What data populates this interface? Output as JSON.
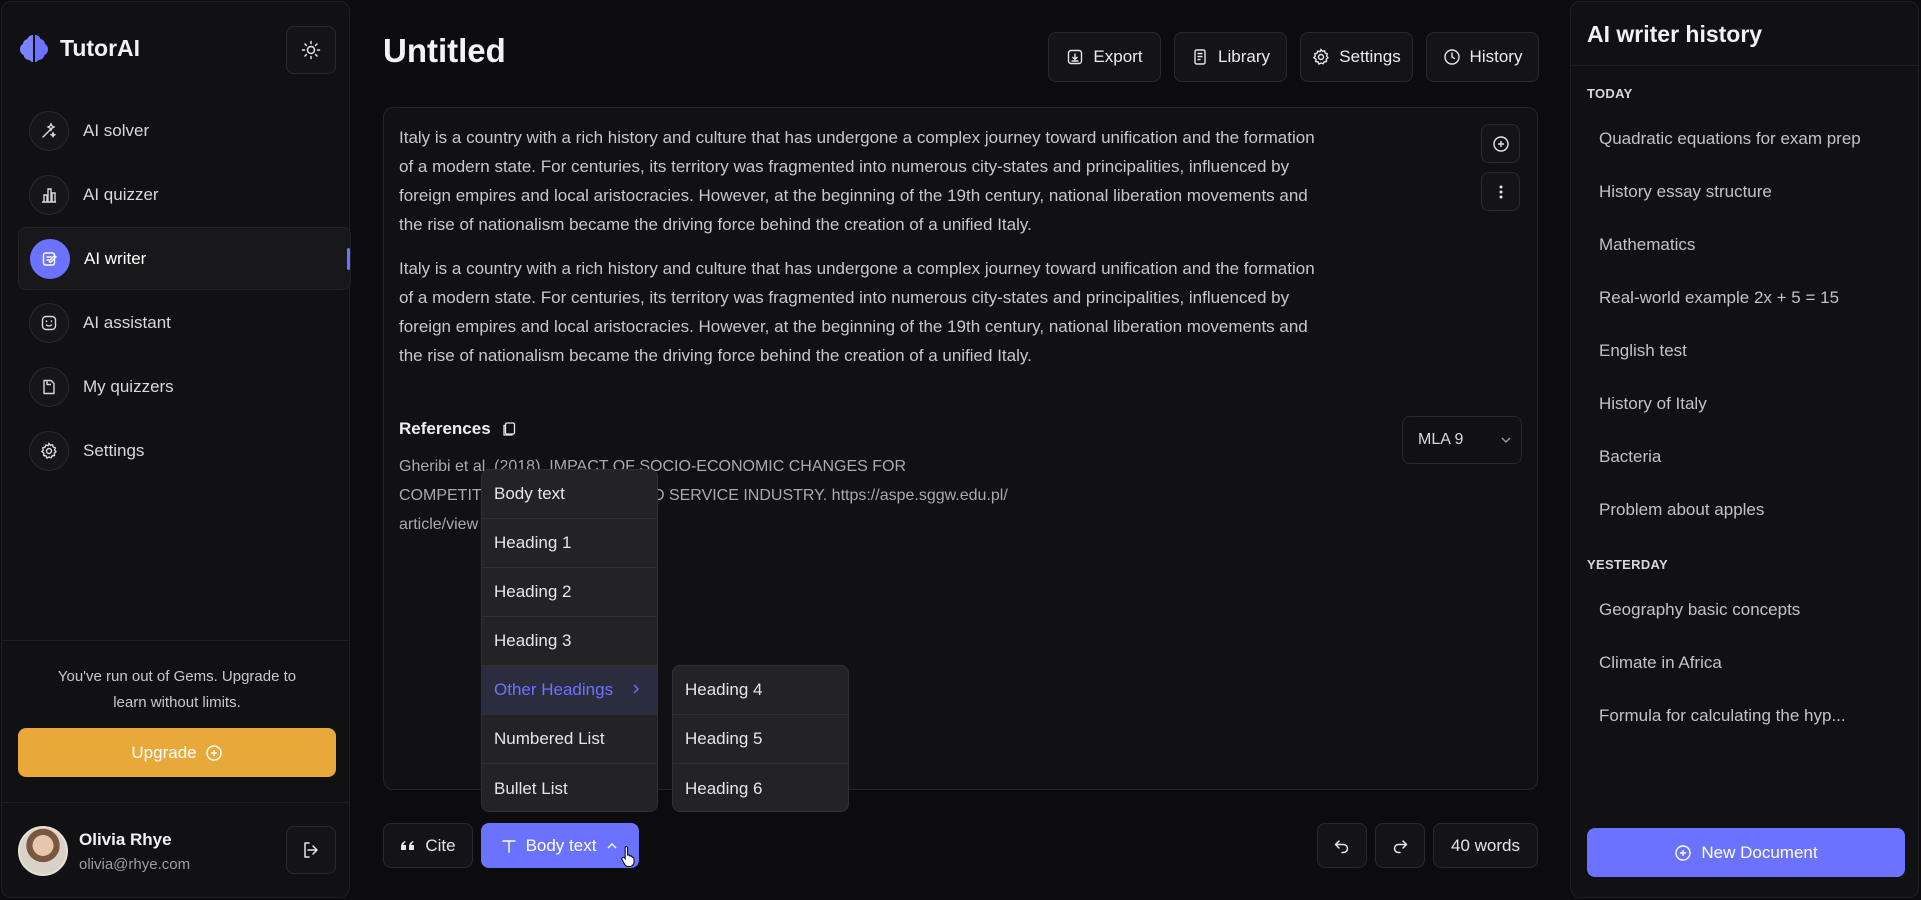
{
  "sidebar": {
    "brand": "TutorAI",
    "nav": [
      {
        "label": "AI solver",
        "icon": "magic-wand-icon"
      },
      {
        "label": "AI quizzer",
        "icon": "bar-chart-icon"
      },
      {
        "label": "AI writer",
        "icon": "edit-icon",
        "active": true
      },
      {
        "label": "AI assistant",
        "icon": "smile-icon"
      },
      {
        "label": "My quizzers",
        "icon": "document-icon"
      },
      {
        "label": "Settings",
        "icon": "gear-icon"
      }
    ],
    "upgrade_message": "You've run out of Gems. Upgrade to learn without limits.",
    "upgrade_label": "Upgrade",
    "user": {
      "name": "Olivia Rhye",
      "email": "olivia@rhye.com"
    }
  },
  "header": {
    "title": "Untitled",
    "buttons": {
      "export": "Export",
      "library": "Library",
      "settings": "Settings",
      "history": "History"
    }
  },
  "editor": {
    "paragraph1": "Italy is a country with a rich history and culture that has undergone a complex journey toward unification and the formation of a modern state. For centuries, its territory was fragmented into numerous city-states and principalities, influenced by foreign empires and local aristocracies. However, at the beginning of the 19th century, national liberation movements and the rise of nationalism became the driving force behind the creation of a unified Italy.",
    "paragraph2": "Italy is a country with a rich history and culture that has undergone a complex journey toward unification and the formation of a modern state. For centuries, its territory was fragmented into numerous city-states and principalities, influenced by foreign empires and local aristocracies. However, at the beginning of the 19th century, national liberation movements and the rise of nationalism became the driving force behind the creation of a unified Italy.",
    "references_title": "References",
    "reference_line1": "Gheribi et al. (2018). IMPACT OF SOCIO-ECONOMIC CHANGES FOR",
    "reference_line2": "COMPETITIVENESS OF THE FOOD SERVICE INDUSTRY. https://aspe.sggw.edu.pl/",
    "reference_line3": "article/view",
    "citation_style": "MLA 9"
  },
  "format_menu": {
    "items": [
      "Body text",
      "Heading 1",
      "Heading 2",
      "Heading 3",
      "Other Headings",
      "Numbered List",
      "Bullet List"
    ],
    "highlighted": "Other Headings",
    "submenu": [
      "Heading 4",
      "Heading 5",
      "Heading 6"
    ]
  },
  "toolbar": {
    "cite_label": "Cite",
    "format_label": "Body text",
    "word_count": "40 words"
  },
  "history": {
    "title": "AI writer history",
    "sections": [
      {
        "label": "TODAY",
        "items": [
          "Quadratic equations for exam prep",
          "History essay structure",
          "Mathematics",
          "Real-world example 2x + 5 = 15",
          "English test",
          "History of Italy",
          "Bacteria",
          "Problem about apples"
        ]
      },
      {
        "label": "YESTERDAY",
        "items": [
          "Geography basic concepts",
          "Climate in Africa",
          "Formula for calculating the hyp..."
        ]
      }
    ],
    "new_document_label": "New Document"
  },
  "colors": {
    "accent": "#6b72ff",
    "upgrade": "#e8a93a",
    "background": "#0c0c0e"
  }
}
